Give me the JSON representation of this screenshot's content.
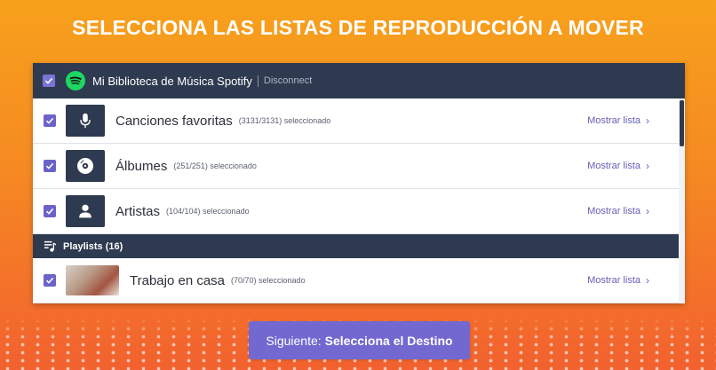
{
  "headline": "SELECCIONA LAS LISTAS DE REPRODUCCIÓN A MOVER",
  "library": {
    "name": "Mi Biblioteca de Música Spotify",
    "disconnect": "Disconnect"
  },
  "rows": [
    {
      "title": "Canciones favoritas",
      "sub": "(3131/3131) seleccionado",
      "link": "Mostrar lista",
      "icon": "microphone-icon"
    },
    {
      "title": "Álbumes",
      "sub": "(251/251) seleccionado",
      "link": "Mostrar lista",
      "icon": "disc-icon"
    },
    {
      "title": "Artistas",
      "sub": "(104/104) seleccionado",
      "link": "Mostrar lista",
      "icon": "person-icon"
    }
  ],
  "playlists": {
    "label": "Playlists (16)",
    "items": [
      {
        "title": "Trabajo en casa",
        "sub": "(70/70) seleccionado",
        "link": "Mostrar lista"
      }
    ]
  },
  "next_button": {
    "prefix": "Siguiente:",
    "strong": "Selecciona el Destino"
  },
  "colors": {
    "accent": "#7268d0",
    "header": "#2e3a4f",
    "spotify": "#1ed760"
  }
}
